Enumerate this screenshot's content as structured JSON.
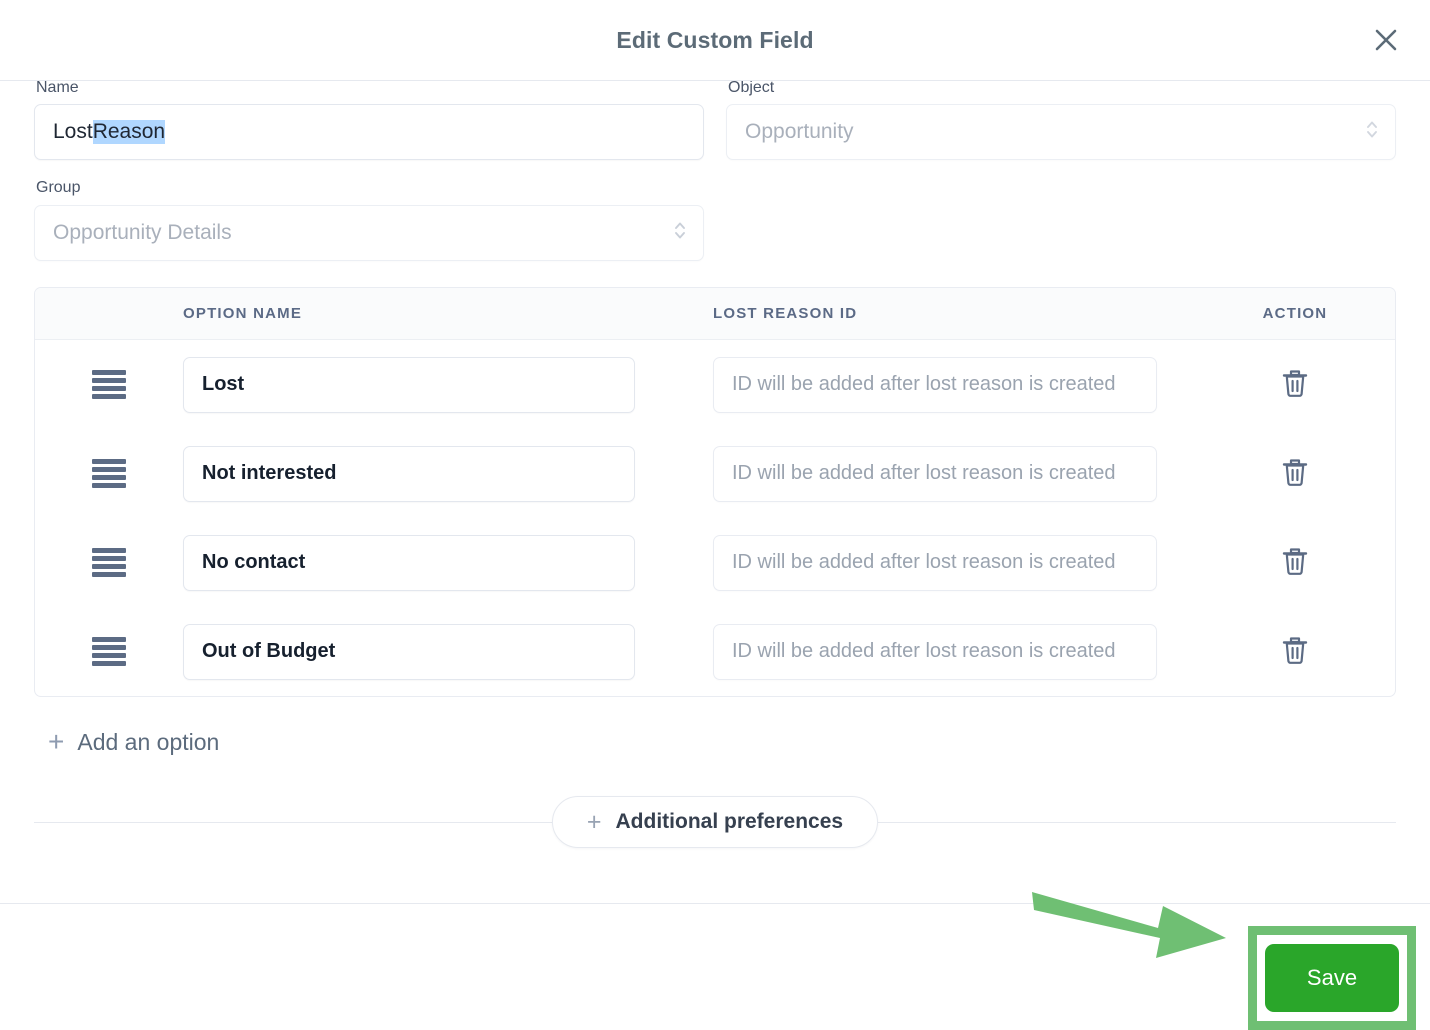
{
  "modal": {
    "title": "Edit Custom Field",
    "close_icon": "close-icon"
  },
  "form": {
    "name_label": "Name",
    "name_value_plain": "Lost ",
    "name_value_selected": "Reason",
    "object_label": "Object",
    "object_value": "Opportunity",
    "group_label": "Group",
    "group_value": "Opportunity Details"
  },
  "options_table": {
    "headers": {
      "option_name": "OPTION NAME",
      "lost_reason_id": "LOST REASON ID",
      "action": "ACTION"
    },
    "rows": [
      {
        "name": "Lost",
        "id_placeholder": "ID will be added after lost reason is created"
      },
      {
        "name": "Not interested",
        "id_placeholder": "ID will be added after lost reason is created"
      },
      {
        "name": "No contact",
        "id_placeholder": "ID will be added after lost reason is created"
      },
      {
        "name": "Out of Budget",
        "id_placeholder": "ID will be added after lost reason is created"
      }
    ]
  },
  "actions": {
    "add_option_plus": "+",
    "add_option_label": "Add an option",
    "additional_preferences_plus": "+",
    "additional_preferences_label": "Additional preferences",
    "save_label": "Save"
  },
  "colors": {
    "save_button": "#2aa62a",
    "annotation_border": "#6fbf73",
    "arrow": "#6fbf73",
    "title_text": "#5c6b77",
    "selection_highlight": "#b0d7ff"
  }
}
